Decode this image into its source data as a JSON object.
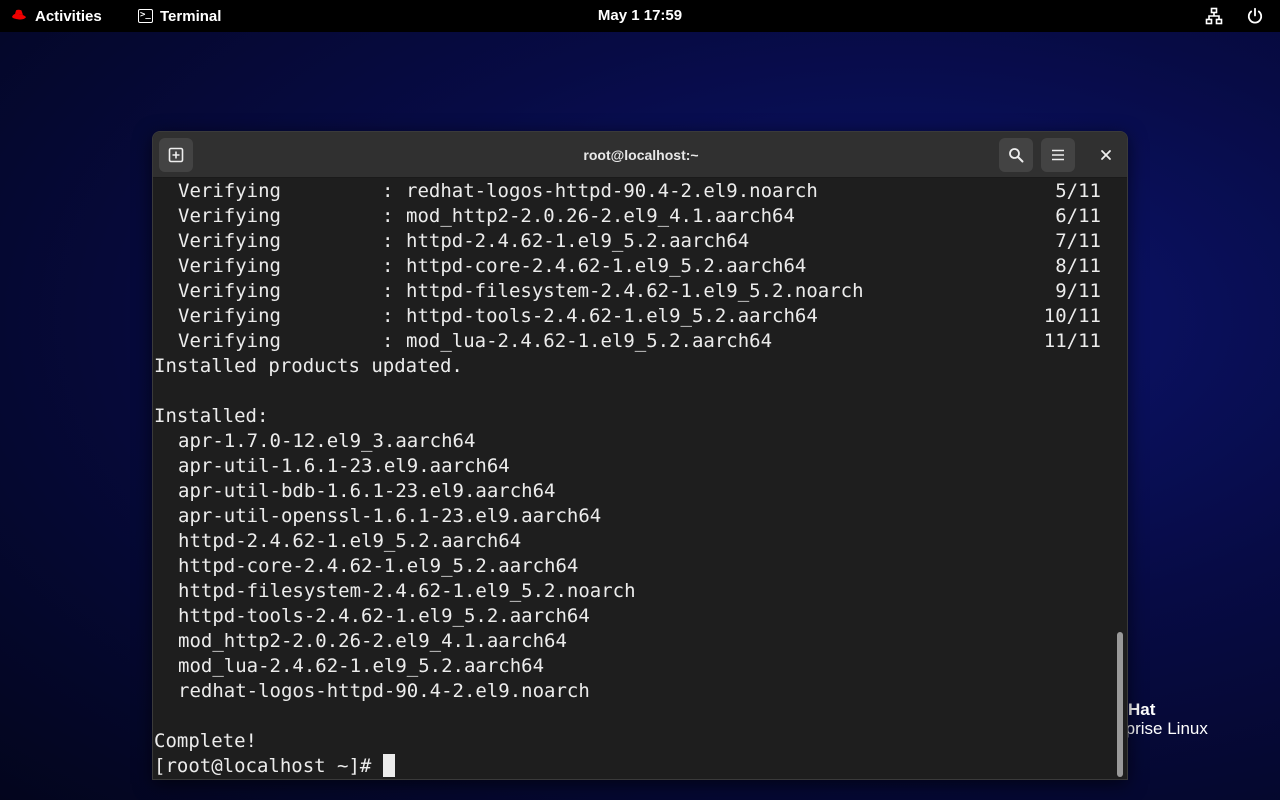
{
  "topbar": {
    "activities_label": "Activities",
    "app_label": "Terminal",
    "clock": "May 1  17:59",
    "network_icon": "network-wired-icon",
    "power_icon": "power-icon"
  },
  "desktop_logo": {
    "line1": "Hat",
    "line2": "rprise Linux"
  },
  "window": {
    "title": "root@localhost:~",
    "new_tab_icon": "new-tab-icon",
    "search_icon": "search-icon",
    "menu_icon": "hamburger-menu-icon",
    "close_icon": "close-icon"
  },
  "terminal": {
    "verify_rows": [
      {
        "label": "Verifying",
        "sep": ":",
        "pkg": "redhat-logos-httpd-90.4-2.el9.noarch",
        "count": "5/11"
      },
      {
        "label": "Verifying",
        "sep": ":",
        "pkg": "mod_http2-2.0.26-2.el9_4.1.aarch64",
        "count": "6/11"
      },
      {
        "label": "Verifying",
        "sep": ":",
        "pkg": "httpd-2.4.62-1.el9_5.2.aarch64",
        "count": "7/11"
      },
      {
        "label": "Verifying",
        "sep": ":",
        "pkg": "httpd-core-2.4.62-1.el9_5.2.aarch64",
        "count": "8/11"
      },
      {
        "label": "Verifying",
        "sep": ":",
        "pkg": "httpd-filesystem-2.4.62-1.el9_5.2.noarch",
        "count": "9/11"
      },
      {
        "label": "Verifying",
        "sep": ":",
        "pkg": "httpd-tools-2.4.62-1.el9_5.2.aarch64",
        "count": "10/11"
      },
      {
        "label": "Verifying",
        "sep": ":",
        "pkg": "mod_lua-2.4.62-1.el9_5.2.aarch64",
        "count": "11/11"
      }
    ],
    "products_updated": "Installed products updated.",
    "installed_header": "Installed:",
    "installed": [
      "apr-1.7.0-12.el9_3.aarch64",
      "apr-util-1.6.1-23.el9.aarch64",
      "apr-util-bdb-1.6.1-23.el9.aarch64",
      "apr-util-openssl-1.6.1-23.el9.aarch64",
      "httpd-2.4.62-1.el9_5.2.aarch64",
      "httpd-core-2.4.62-1.el9_5.2.aarch64",
      "httpd-filesystem-2.4.62-1.el9_5.2.noarch",
      "httpd-tools-2.4.62-1.el9_5.2.aarch64",
      "mod_http2-2.0.26-2.el9_4.1.aarch64",
      "mod_lua-2.4.62-1.el9_5.2.aarch64",
      "redhat-logos-httpd-90.4-2.el9.noarch"
    ],
    "complete": "Complete!",
    "prompt": "[root@localhost ~]# "
  }
}
